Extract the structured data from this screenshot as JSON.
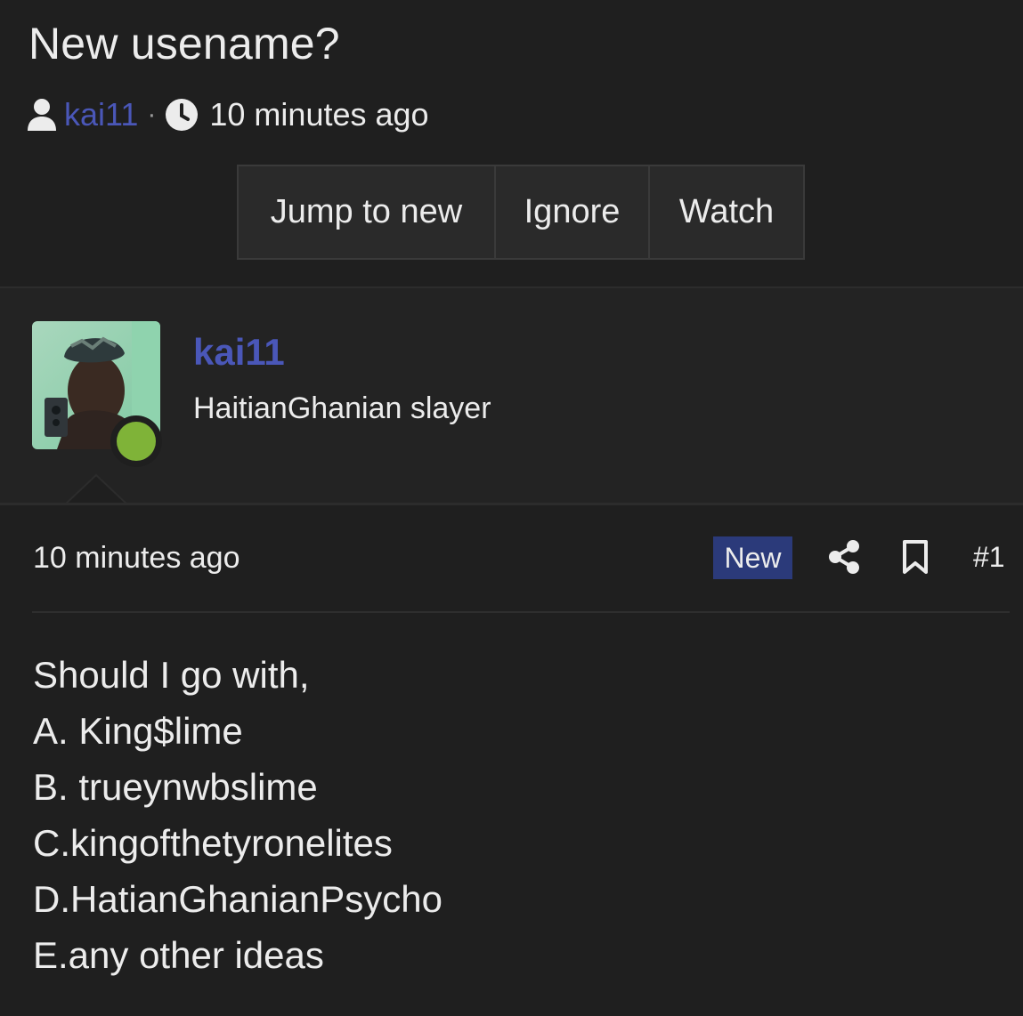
{
  "thread": {
    "title": "New usename?",
    "author": "kai11",
    "separator": "·",
    "time": "10 minutes ago"
  },
  "actions": {
    "jump": "Jump to new",
    "ignore": "Ignore",
    "watch": "Watch"
  },
  "user": {
    "name": "kai11",
    "title": "HaitianGhanian slayer",
    "online_color": "#7fb338"
  },
  "post": {
    "time": "10 minutes ago",
    "badge": "New",
    "number": "#1",
    "lines": [
      "Should I go with,",
      "A. King$lime",
      "B. trueynwbslime",
      "C.kingofthetyronelites",
      "D.HatianGhanianPsycho",
      "E.any other ideas"
    ]
  },
  "colors": {
    "background": "#1f1f1f",
    "link": "#4a57b8",
    "badge_bg": "#2b3a7a"
  }
}
